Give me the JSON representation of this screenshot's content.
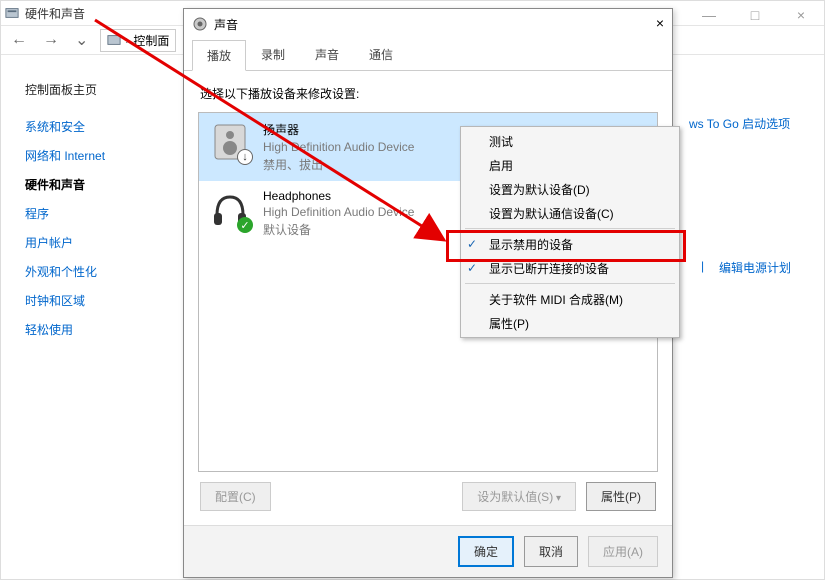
{
  "control_panel": {
    "title": "硬件和声音",
    "window_buttons": {
      "min": "—",
      "max": "□",
      "close": "×"
    },
    "address": {
      "back": "←",
      "fwd": "→",
      "dropdown": "⌄",
      "crumb": "控制面"
    },
    "sidebar": {
      "home": "控制面板主页",
      "items": [
        "系统和安全",
        "网络和 Internet",
        "硬件和声音",
        "程序",
        "用户帐户",
        "外观和个性化",
        "时钟和区域",
        "轻松使用"
      ]
    },
    "main_links": {
      "wtg": "ws To Go 启动选项",
      "edit_power_plan": "编辑电源计划"
    }
  },
  "sound_dialog": {
    "title": "声音",
    "close": "×",
    "tabs": {
      "playback": "播放",
      "recording": "录制",
      "sounds": "声音",
      "comm": "通信"
    },
    "instruction": "选择以下播放设备来修改设置:",
    "devices": [
      {
        "name": "扬声器",
        "sub1": "High Definition Audio Device",
        "sub2": "禁用、拔出",
        "badge": "down"
      },
      {
        "name": "Headphones",
        "sub1": "High Definition Audio Device",
        "sub2": "默认设备",
        "badge": "ok"
      }
    ],
    "buttons": {
      "configure": "配置(C)",
      "set_default": "设为默认值(S)",
      "properties": "属性(P)",
      "ok": "确定",
      "cancel": "取消",
      "apply": "应用(A)"
    }
  },
  "context_menu": {
    "items": [
      {
        "label": "测试",
        "checked": false
      },
      {
        "label": "启用",
        "checked": false
      },
      {
        "label": "设置为默认设备(D)",
        "checked": false
      },
      {
        "label": "设置为默认通信设备(C)",
        "checked": false
      },
      {
        "sep": true
      },
      {
        "label": "显示禁用的设备",
        "checked": true
      },
      {
        "label": "显示已断开连接的设备",
        "checked": true
      },
      {
        "sep": true
      },
      {
        "label": "关于软件 MIDI 合成器(M)",
        "checked": false
      },
      {
        "label": "属性(P)",
        "checked": false
      }
    ]
  }
}
